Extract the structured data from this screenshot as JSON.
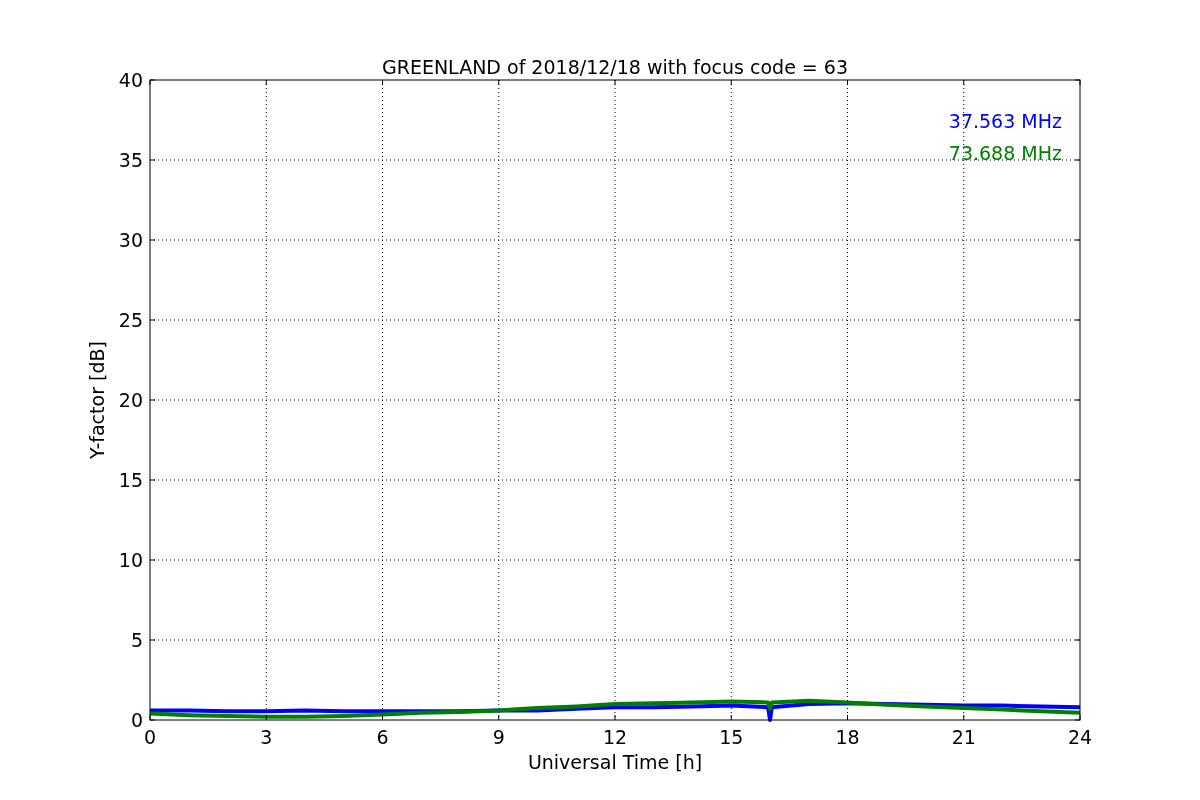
{
  "chart_data": {
    "type": "line",
    "title": "GREENLAND of 2018/12/18 with focus code = 63",
    "xlabel": "Universal Time [h]",
    "ylabel": "Y-factor [dB]",
    "x": [
      0,
      1,
      2,
      3,
      4,
      5,
      6,
      7,
      8,
      9,
      10,
      11,
      12,
      13,
      14,
      15,
      15.95,
      16,
      16.05,
      17,
      18,
      19,
      20,
      21,
      22,
      23,
      24
    ],
    "series": [
      {
        "name": "37.563 MHz",
        "color": "#0000ff",
        "values": [
          0.6,
          0.6,
          0.55,
          0.55,
          0.6,
          0.55,
          0.55,
          0.55,
          0.55,
          0.6,
          0.6,
          0.7,
          0.8,
          0.8,
          0.85,
          0.9,
          0.8,
          0.0,
          0.8,
          1.0,
          1.05,
          1.0,
          0.95,
          0.9,
          0.9,
          0.85,
          0.8
        ]
      },
      {
        "name": "73.688 MHz",
        "color": "#008000",
        "values": [
          0.4,
          0.3,
          0.25,
          0.2,
          0.2,
          0.25,
          0.35,
          0.45,
          0.5,
          0.6,
          0.75,
          0.85,
          1.0,
          1.05,
          1.1,
          1.15,
          1.1,
          0.7,
          1.1,
          1.2,
          1.1,
          0.95,
          0.85,
          0.75,
          0.65,
          0.55,
          0.45
        ]
      }
    ],
    "xlim": [
      0,
      24
    ],
    "ylim": [
      0,
      40
    ],
    "xticks": [
      0,
      3,
      6,
      9,
      12,
      15,
      18,
      21,
      24
    ],
    "yticks": [
      0,
      5,
      10,
      15,
      20,
      25,
      30,
      35,
      40
    ],
    "grid": true
  }
}
